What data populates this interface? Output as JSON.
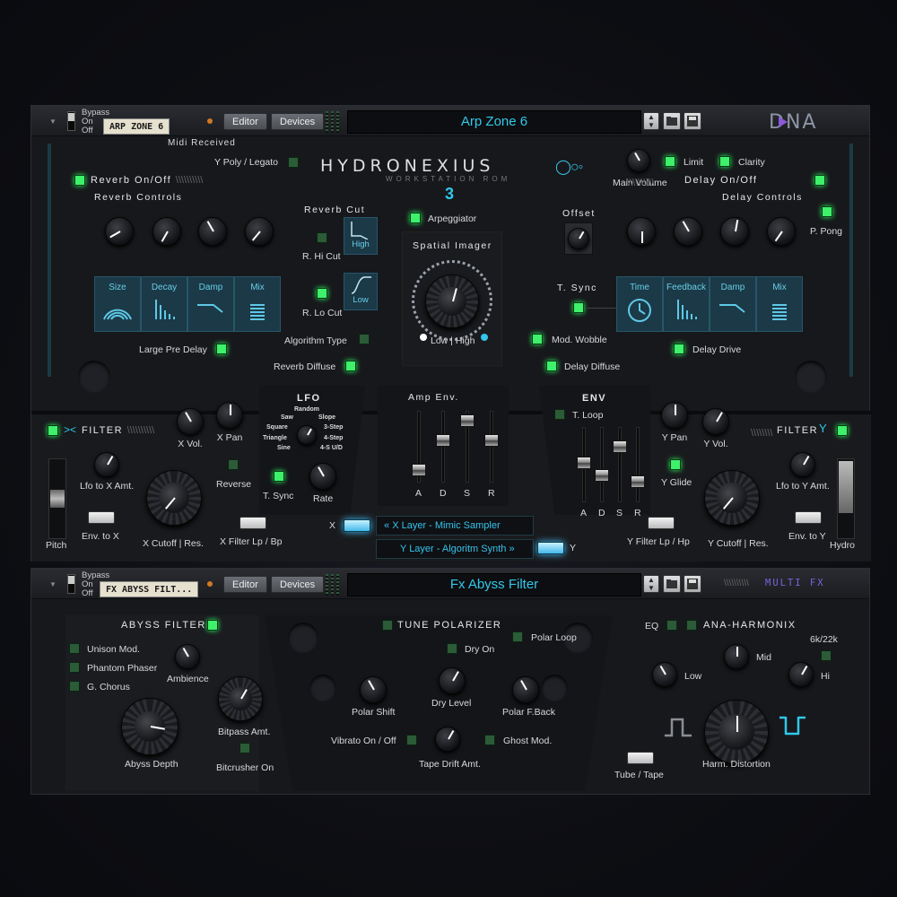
{
  "top_rack": {
    "bypass": [
      "Bypass",
      "On",
      "Off"
    ],
    "patch_name": "ARP ZONE 6",
    "editor_btn": "Editor",
    "devices_btn": "Devices",
    "display": "Arp Zone 6",
    "brand": "DNA",
    "midi_received": "Midi Received",
    "y_poly": "Y Poly / Legato",
    "logo_title": "HYDRONEXIUS",
    "logo_sub": "WORKSTATION ROM",
    "logo_num": "3",
    "main_volume": "Main Volume",
    "limit": "Limit",
    "clarity": "Clarity",
    "reverb_onoff": "Reverb On/Off",
    "reverb_controls": "Reverb Controls",
    "reverb_boxes": [
      "Size",
      "Decay",
      "Damp",
      "Mix"
    ],
    "reverb_cut": "Reverb Cut",
    "high": "High",
    "low": "Low",
    "r_hi_cut": "R. Hi Cut",
    "r_lo_cut": "R. Lo Cut",
    "arpeggiator": "Arpeggiator",
    "spatial_imager": "Spatial Imager",
    "low_high": "Low | High",
    "offset": "Offset",
    "t_sync": "T. Sync",
    "delay_onoff": "Delay On/Off",
    "delay_controls": "Delay Controls",
    "p_pong": "P. Pong",
    "delay_boxes": [
      "Time",
      "Feedback",
      "Damp",
      "Mix"
    ],
    "large_pre_delay": "Large Pre Delay",
    "algorithm_type": "Algorithm Type",
    "reverb_diffuse": "Reverb Diffuse",
    "mod_wobble": "Mod. Wobble",
    "delay_diffuse": "Delay Diffuse",
    "delay_drive": "Delay Drive",
    "filter_x": "FILTER",
    "filter_y": "FILTER",
    "x_vol": "X Vol.",
    "x_pan": "X Pan",
    "lfo_to_x": "Lfo to X Amt.",
    "reverse": "Reverse",
    "pitch": "Pitch",
    "env_to_x": "Env. to X",
    "x_cutoff": "X Cutoff | Res.",
    "x_filter_lp": "X Filter Lp / Bp",
    "lfo": "LFO",
    "lfo_waves": [
      "Random",
      "Saw",
      "Slope",
      "Square",
      "3-Step",
      "Triangle",
      "4-Step",
      "Sine",
      "4-S U/D"
    ],
    "lfo_tsync": "T. Sync",
    "rate": "Rate",
    "amp_env": "Amp Env.",
    "adsr": [
      "A",
      "D",
      "S",
      "R"
    ],
    "amp_env_levels": [
      0.12,
      0.62,
      0.95,
      0.62
    ],
    "env": "ENV",
    "t_loop": "T. Loop",
    "env_levels": [
      0.55,
      0.35,
      0.8,
      0.25
    ],
    "y_pan": "Y Pan",
    "y_vol": "Y Vol.",
    "y_glide": "Y Glide",
    "lfo_to_y": "Lfo to Y Amt.",
    "env_to_y": "Env. to Y",
    "hydro": "Hydro",
    "y_cutoff": "Y Cutoff | Res.",
    "y_filter_lp": "Y Filter Lp / Hp",
    "x": "X",
    "y": "Y",
    "x_layer": "X Layer - Mimic Sampler",
    "y_layer": "Y Layer - Algoritm Synth",
    "icons": {
      "folder": "folder-icon",
      "save": "save-icon",
      "updown": "up-down-arrows-icon"
    }
  },
  "bottom_rack": {
    "bypass": [
      "Bypass",
      "On",
      "Off"
    ],
    "patch_name": "FX ABYSS FILT...",
    "editor_btn": "Editor",
    "devices_btn": "Devices",
    "display": "Fx Abyss Filter",
    "multi_fx": "MULTI FX",
    "abyss_filter": "ABYSS FILTER",
    "unison_mod": "Unison Mod.",
    "phantom_phaser": "Phantom Phaser",
    "g_chorus": "G. Chorus",
    "ambience": "Ambience",
    "abyss_depth": "Abyss Depth",
    "bitpass_amt": "Bitpass Amt.",
    "bitcrusher_on": "Bitcrusher On",
    "tune_polarizer": "TUNE POLARIZER",
    "dry_on": "Dry On",
    "polar_loop": "Polar Loop",
    "polar_shift": "Polar Shift",
    "dry_level": "Dry Level",
    "polar_fback": "Polar F.Back",
    "vibrato": "Vibrato On / Off",
    "tape_drift": "Tape Drift Amt.",
    "ghost_mod": "Ghost Mod.",
    "eq": "EQ",
    "ana_harmonix": "ANA-HARMONIX",
    "freq": "6k/22k",
    "mid": "Mid",
    "low": "Low",
    "hi": "Hi",
    "tube_tape": "Tube / Tape",
    "harm_distortion": "Harm. Distortion"
  },
  "colors": {
    "accent": "#30c8ea",
    "led_on": "#3ef06a",
    "panel": "#1b1c20",
    "tile": "#1b3947"
  }
}
